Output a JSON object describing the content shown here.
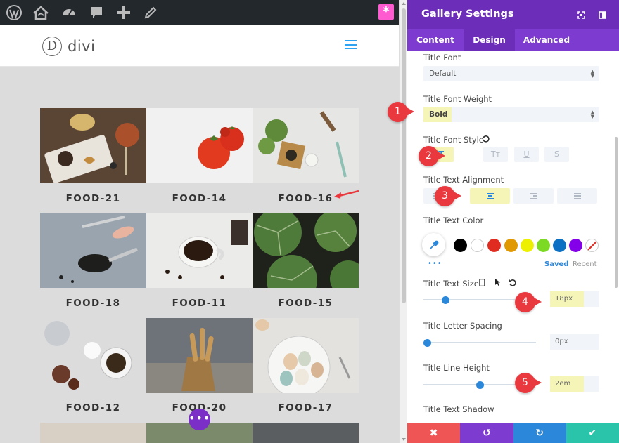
{
  "colors": {
    "admin_bar": "#23282d",
    "panel_header": "#6c2eb9",
    "panel_tabs": "#7d3bcf",
    "active_tab": "#6c2eb9",
    "accent_blue": "#2b87da",
    "marker_red": "#e9393f",
    "highlight": "#f5f5b8",
    "cancel": "#ef5555",
    "undo": "#7e3bd0",
    "redo": "#2b87da",
    "save": "#29c4a9"
  },
  "admin_bar": {
    "icons": [
      "wordpress-icon",
      "home-icon",
      "dashboard-icon",
      "comment-icon",
      "plus-icon",
      "pencil-icon"
    ],
    "right_icon": "asterisk-icon",
    "right_label": "*"
  },
  "site": {
    "logo_letter": "D",
    "logo_text": "divi",
    "menu_icon": "hamburger-icon"
  },
  "gallery": {
    "items": [
      {
        "caption": "FOOD-21"
      },
      {
        "caption": "FOOD-14"
      },
      {
        "caption": "FOOD-16"
      },
      {
        "caption": "FOOD-18"
      },
      {
        "caption": "FOOD-11"
      },
      {
        "caption": "FOOD-15"
      },
      {
        "caption": "FOOD-12"
      },
      {
        "caption": "FOOD-20"
      },
      {
        "caption": "FOOD-17"
      }
    ],
    "dots_label": "•••"
  },
  "panel": {
    "title": "Gallery Settings",
    "tabs": [
      {
        "label": "Content"
      },
      {
        "label": "Design"
      },
      {
        "label": "Advanced"
      }
    ],
    "active_tab": "Design",
    "title_font": {
      "label": "Title Font",
      "value": "Default"
    },
    "title_font_weight": {
      "label": "Title Font Weight",
      "value": "Bold"
    },
    "title_font_style": {
      "label": "Title Font Style",
      "buttons": [
        "TT",
        "Tт",
        "U",
        "S"
      ],
      "active": "TT"
    },
    "title_text_alignment": {
      "label": "Title Text Alignment",
      "active": "center"
    },
    "title_text_color": {
      "label": "Title Text Color",
      "swatches": [
        "#000000",
        "#ffffff",
        "#e02b20",
        "#e09900",
        "#edf000",
        "#7cda24",
        "#0c71c3",
        "#8300e9"
      ],
      "saved_label": "Saved",
      "recent_label": "Recent",
      "more": "•••"
    },
    "title_text_size": {
      "label": "Title Text Size",
      "value": "18px",
      "slider_fraction": 0.17
    },
    "title_letter_spacing": {
      "label": "Title Letter Spacing",
      "value": "0px",
      "slider_fraction": 0.0
    },
    "title_line_height": {
      "label": "Title Line Height",
      "value": "2em",
      "slider_fraction": 0.5
    },
    "title_text_shadow": {
      "label": "Title Text Shadow"
    }
  },
  "markers": [
    "1",
    "2",
    "3",
    "4",
    "5"
  ],
  "bottom_bar": {
    "cancel": "✖",
    "undo": "↺",
    "redo": "↻",
    "save": "✔"
  }
}
